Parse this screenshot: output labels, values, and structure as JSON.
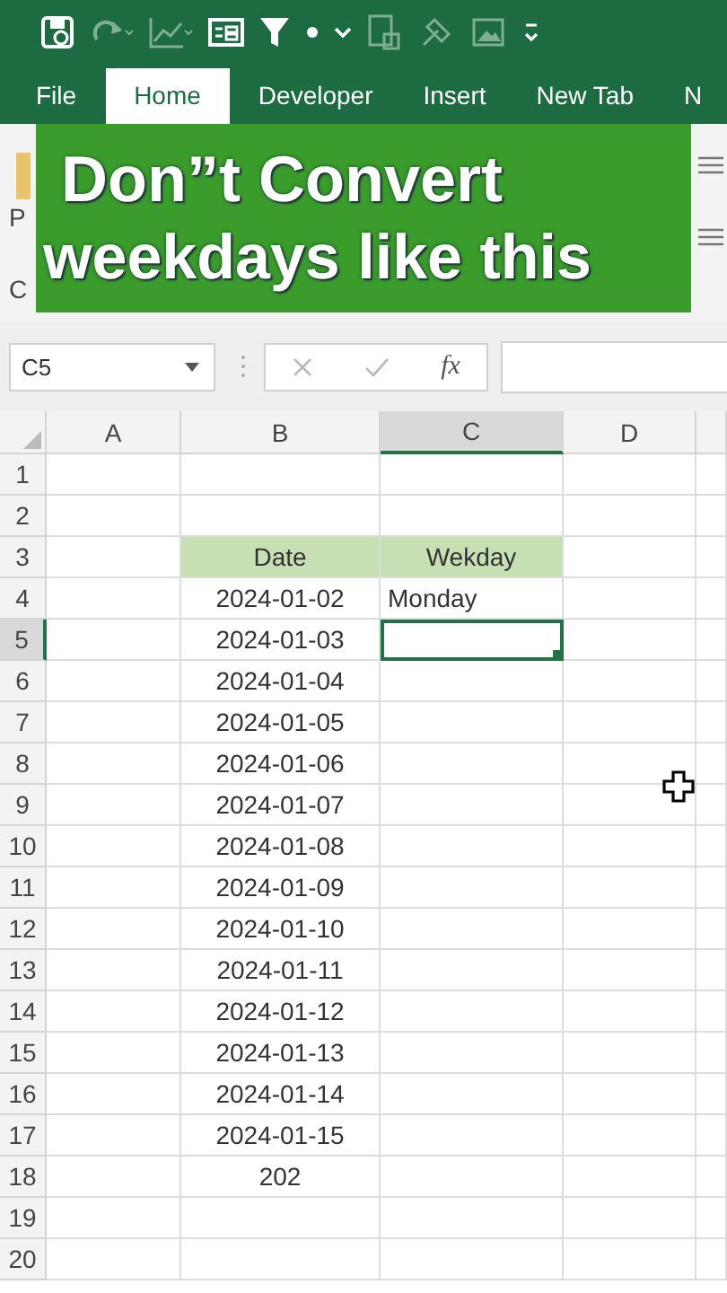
{
  "tabs": [
    {
      "label": "File",
      "selected": false
    },
    {
      "label": "Home",
      "selected": true
    },
    {
      "label": "Developer",
      "selected": false
    },
    {
      "label": "Insert",
      "selected": false
    },
    {
      "label": "New Tab",
      "selected": false
    },
    {
      "label": "N",
      "selected": false
    }
  ],
  "ribbon": {
    "fragments": [
      "P",
      "C"
    ]
  },
  "caption": {
    "lines": [
      "Don”t Convert",
      "weekdays like this"
    ]
  },
  "formula_bar": {
    "name_box": "C5",
    "function_label": "fx"
  },
  "grid": {
    "columns": [
      {
        "label": "A",
        "selected": false
      },
      {
        "label": "B",
        "selected": false
      },
      {
        "label": "C",
        "selected": true
      },
      {
        "label": "D",
        "selected": false
      }
    ],
    "rows": [
      {
        "number": "1",
        "selected": false,
        "cells": [
          {
            "selected": false
          },
          {
            "selected": false
          },
          {
            "selected": false
          },
          {
            "selected": false
          }
        ]
      },
      {
        "number": "2",
        "selected": false,
        "cells": [
          {
            "selected": false
          },
          {
            "selected": false
          },
          {
            "selected": false
          },
          {
            "selected": false
          }
        ]
      },
      {
        "number": "3",
        "selected": false,
        "cells": [
          {
            "selected": false
          },
          {
            "selected": false,
            "text": "Date",
            "kind": "header"
          },
          {
            "selected": false,
            "text": "Wekday",
            "kind": "header"
          },
          {
            "selected": false
          }
        ]
      },
      {
        "number": "4",
        "selected": false,
        "cells": [
          {
            "selected": false
          },
          {
            "selected": false,
            "text": "2024-01-02",
            "kind": "date"
          },
          {
            "selected": false,
            "text": "Monday",
            "kind": "text"
          },
          {
            "selected": false
          }
        ]
      },
      {
        "number": "5",
        "selected": true,
        "cells": [
          {
            "selected": false
          },
          {
            "selected": false,
            "text": "2024-01-03",
            "kind": "date"
          },
          {
            "selected": true
          },
          {
            "selected": false
          }
        ]
      },
      {
        "number": "6",
        "selected": false,
        "cells": [
          {
            "selected": false
          },
          {
            "selected": false,
            "text": "2024-01-04",
            "kind": "date"
          },
          {
            "selected": false
          },
          {
            "selected": false
          }
        ]
      },
      {
        "number": "7",
        "selected": false,
        "cells": [
          {
            "selected": false
          },
          {
            "selected": false,
            "text": "2024-01-05",
            "kind": "date"
          },
          {
            "selected": false
          },
          {
            "selected": false
          }
        ]
      },
      {
        "number": "8",
        "selected": false,
        "cells": [
          {
            "selected": false
          },
          {
            "selected": false,
            "text": "2024-01-06",
            "kind": "date"
          },
          {
            "selected": false
          },
          {
            "selected": false
          }
        ]
      },
      {
        "number": "9",
        "selected": false,
        "cells": [
          {
            "selected": false
          },
          {
            "selected": false,
            "text": "2024-01-07",
            "kind": "date"
          },
          {
            "selected": false
          },
          {
            "selected": false
          }
        ]
      },
      {
        "number": "10",
        "selected": false,
        "cells": [
          {
            "selected": false
          },
          {
            "selected": false,
            "text": "2024-01-08",
            "kind": "date"
          },
          {
            "selected": false
          },
          {
            "selected": false
          }
        ]
      },
      {
        "number": "11",
        "selected": false,
        "cells": [
          {
            "selected": false
          },
          {
            "selected": false,
            "text": "2024-01-09",
            "kind": "date"
          },
          {
            "selected": false
          },
          {
            "selected": false
          }
        ]
      },
      {
        "number": "12",
        "selected": false,
        "cells": [
          {
            "selected": false
          },
          {
            "selected": false,
            "text": "2024-01-10",
            "kind": "date"
          },
          {
            "selected": false
          },
          {
            "selected": false
          }
        ]
      },
      {
        "number": "13",
        "selected": false,
        "cells": [
          {
            "selected": false
          },
          {
            "selected": false,
            "text": "2024-01-11",
            "kind": "date"
          },
          {
            "selected": false
          },
          {
            "selected": false
          }
        ]
      },
      {
        "number": "14",
        "selected": false,
        "cells": [
          {
            "selected": false
          },
          {
            "selected": false,
            "text": "2024-01-12",
            "kind": "date"
          },
          {
            "selected": false
          },
          {
            "selected": false
          }
        ]
      },
      {
        "number": "15",
        "selected": false,
        "cells": [
          {
            "selected": false
          },
          {
            "selected": false,
            "text": "2024-01-13",
            "kind": "date"
          },
          {
            "selected": false
          },
          {
            "selected": false
          }
        ]
      },
      {
        "number": "16",
        "selected": false,
        "cells": [
          {
            "selected": false
          },
          {
            "selected": false,
            "text": "2024-01-14",
            "kind": "date"
          },
          {
            "selected": false
          },
          {
            "selected": false
          }
        ]
      },
      {
        "number": "17",
        "selected": false,
        "cells": [
          {
            "selected": false
          },
          {
            "selected": false,
            "text": "2024-01-15",
            "kind": "date"
          },
          {
            "selected": false
          },
          {
            "selected": false
          }
        ]
      },
      {
        "number": "18",
        "selected": false,
        "cells": [
          {
            "selected": false
          },
          {
            "selected": false,
            "text": "202",
            "kind": "date"
          },
          {
            "selected": false
          },
          {
            "selected": false
          }
        ]
      },
      {
        "number": "19",
        "selected": false,
        "cells": [
          {
            "selected": false
          },
          {
            "selected": false
          },
          {
            "selected": false
          },
          {
            "selected": false
          }
        ]
      },
      {
        "number": "20",
        "selected": false,
        "cells": [
          {
            "selected": false
          },
          {
            "selected": false
          },
          {
            "selected": false
          },
          {
            "selected": false
          }
        ]
      }
    ]
  }
}
